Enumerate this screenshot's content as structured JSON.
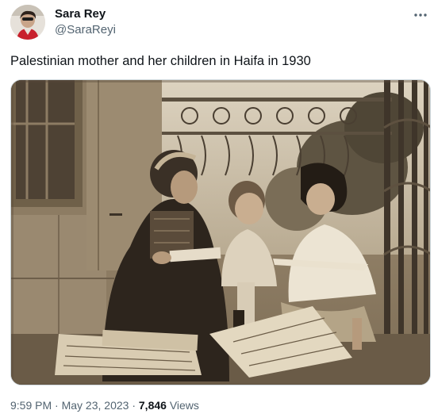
{
  "author": {
    "display_name": "Sara Rey",
    "handle": "@SaraReyi",
    "avatar_icon": "profile-photo"
  },
  "more_icon": "more-options-icon",
  "tweet": {
    "text": "Palestinian mother and her children in Haifa in 1930"
  },
  "media": {
    "kind": "sepia-photograph"
  },
  "meta": {
    "time": "9:59 PM",
    "separator1": " · ",
    "date": "May 23, 2023",
    "separator2": " · ",
    "views_count": "7,846",
    "views_label": " Views"
  },
  "colors": {
    "text_primary": "#0f1419",
    "text_secondary": "#536471",
    "border": "#cfd9de"
  }
}
